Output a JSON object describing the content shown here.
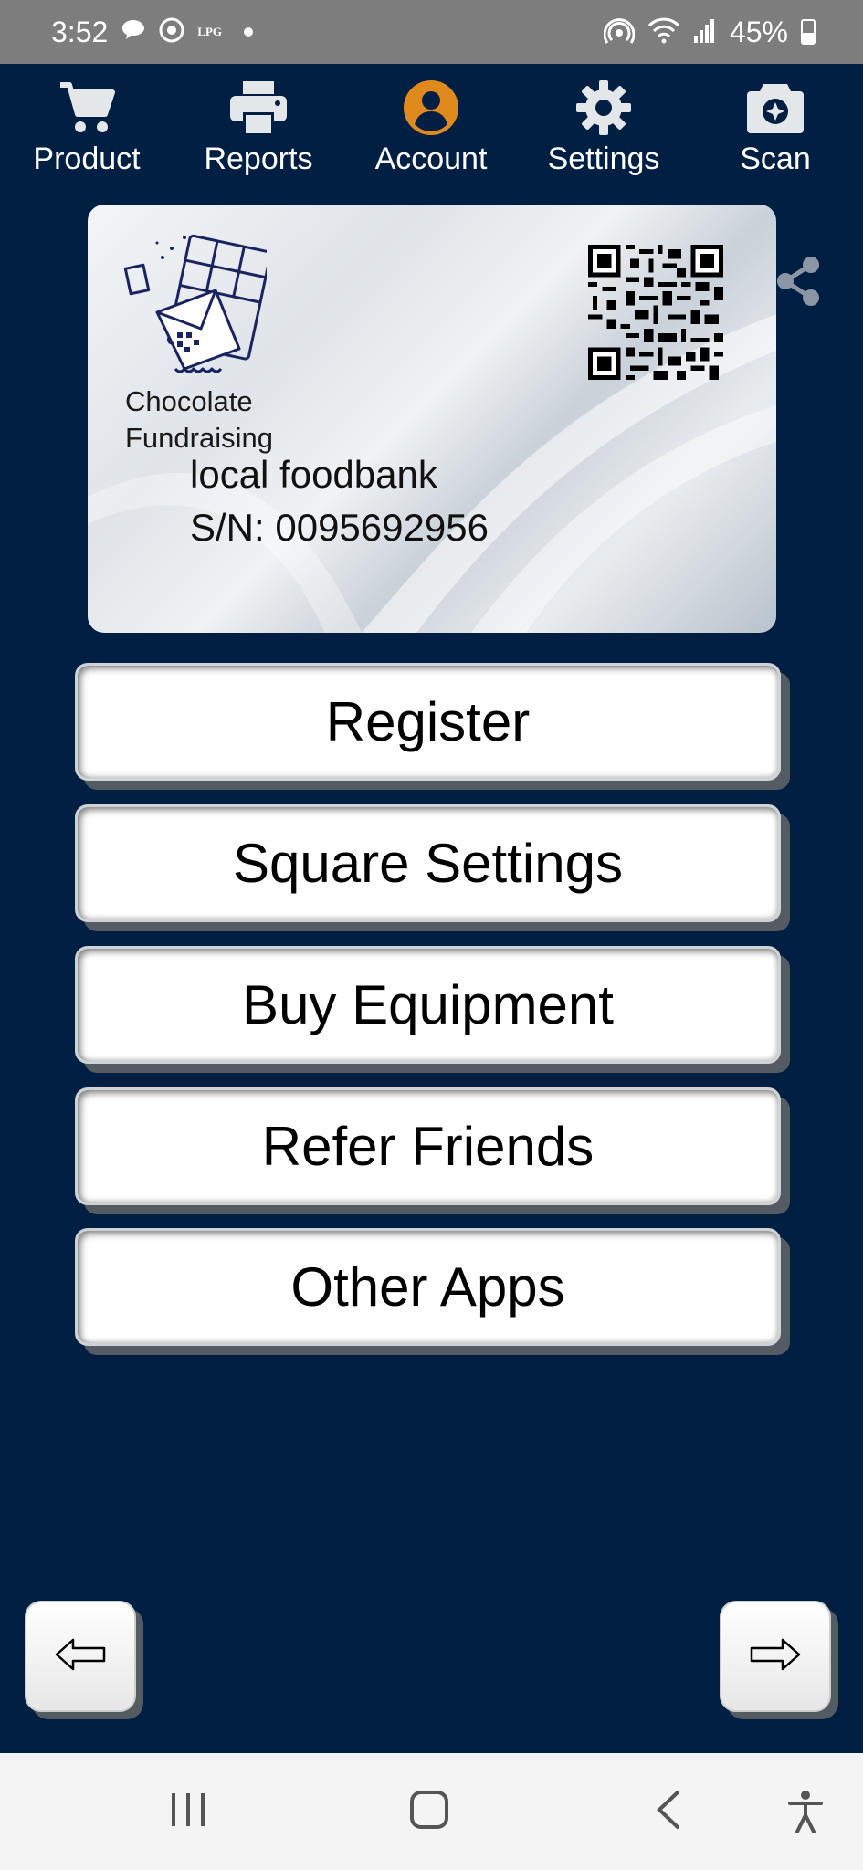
{
  "status_bar": {
    "time": "3:52",
    "carrier_tag": "LPG",
    "battery": "45%"
  },
  "top_nav": {
    "items": [
      {
        "label": "Product",
        "icon": "cart-icon"
      },
      {
        "label": "Reports",
        "icon": "printer-icon"
      },
      {
        "label": "Account",
        "icon": "account-icon",
        "active": true
      },
      {
        "label": "Settings",
        "icon": "gear-icon"
      },
      {
        "label": "Scan",
        "icon": "camera-icon"
      }
    ],
    "active_color": "#e08a1e"
  },
  "card": {
    "logo_text_line1": "Chocolate",
    "logo_text_line2": "Fundraising",
    "name": "local foodbank",
    "serial": "S/N: 0095692956"
  },
  "menu": {
    "buttons": [
      "Register",
      "Square Settings",
      "Buy Equipment",
      "Refer Friends",
      "Other Apps"
    ]
  },
  "colors": {
    "background": "#001f42",
    "status_bar": "#7d7d7d",
    "system_nav": "#f4f4f4"
  }
}
